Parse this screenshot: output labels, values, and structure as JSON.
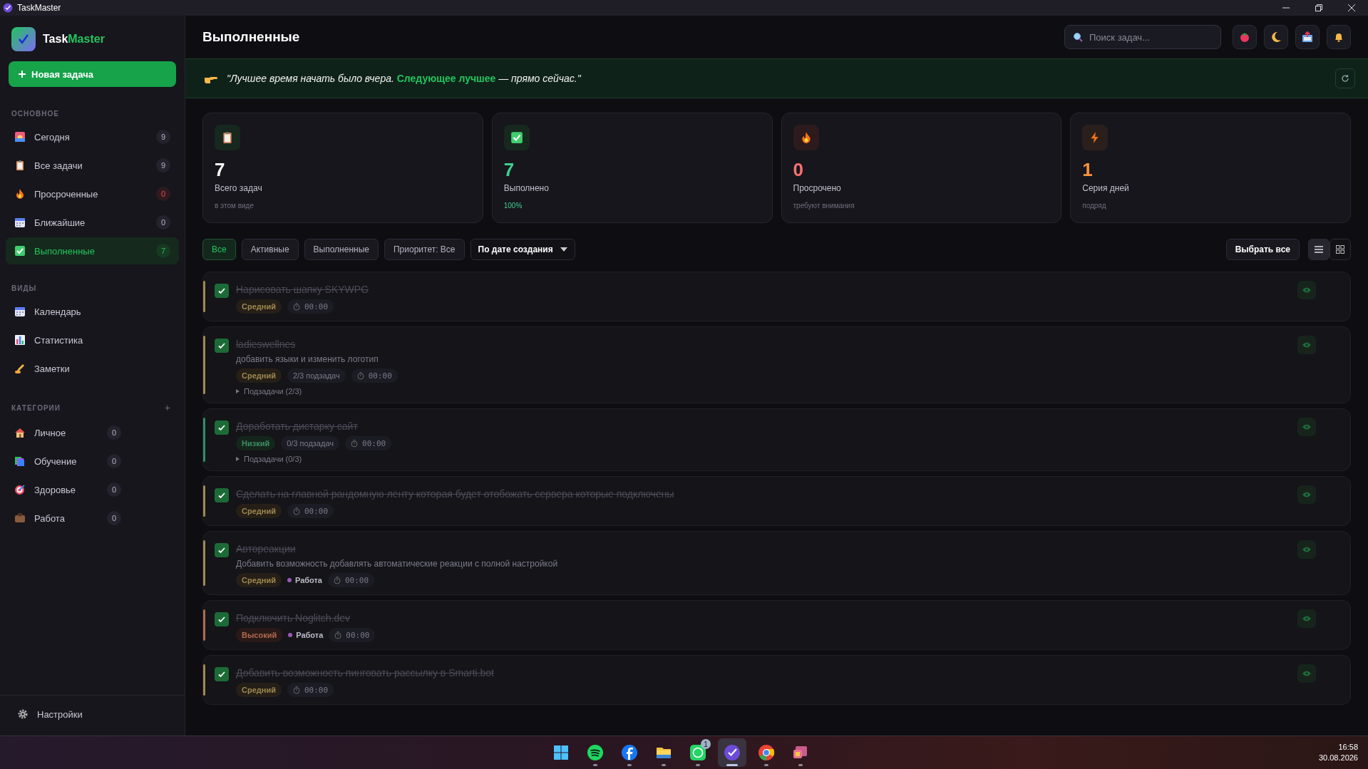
{
  "window": {
    "title": "TaskMaster"
  },
  "app": {
    "logo_part1": "Task",
    "logo_part2": "Master",
    "new_task": "Новая задача"
  },
  "sidebar": {
    "sections": [
      {
        "title": "ОСНОВНОЕ",
        "items": [
          {
            "kind": "today",
            "label": "Сегодня",
            "count": "9",
            "selected": false
          },
          {
            "kind": "all",
            "label": "Все задачи",
            "count": "9",
            "selected": false
          },
          {
            "kind": "overdue",
            "label": "Просроченные",
            "count": "0",
            "selected": false
          },
          {
            "kind": "upcoming",
            "label": "Ближайшие",
            "count": "0",
            "selected": false
          },
          {
            "kind": "done",
            "label": "Выполненные",
            "count": "7",
            "selected": true
          }
        ]
      },
      {
        "title": "ВИДЫ",
        "items": [
          {
            "label": "Календарь",
            "selected": false
          },
          {
            "label": "Статистика",
            "selected": false
          },
          {
            "label": "Заметки",
            "selected": false
          }
        ]
      },
      {
        "title": "КАТЕГОРИИ",
        "add": "+",
        "items": [
          {
            "label": "Личное",
            "count": "0",
            "selected": false
          },
          {
            "label": "Обучение",
            "count": "0",
            "selected": false
          },
          {
            "label": "Здоровье",
            "count": "0",
            "selected": false
          },
          {
            "label": "Работа",
            "count": "0",
            "selected": false
          }
        ]
      }
    ],
    "settings": "Настройки"
  },
  "header": {
    "title": "Выполненные",
    "search": {
      "placeholder": "Поиск задач..."
    }
  },
  "quote": {
    "before": "\"Лучшее время начать было вчера. ",
    "highlight": "Следующее лучшее",
    "after": " — прямо сейчас.\""
  },
  "stats": [
    {
      "kind": "total",
      "value": "7",
      "label": "Всего задач",
      "note": "в этом виде"
    },
    {
      "kind": "done",
      "value": "7",
      "label": "Выполнено",
      "note": "100%"
    },
    {
      "kind": "overdue",
      "value": "0",
      "label": "Просрочено",
      "note": "требуют внимания"
    },
    {
      "kind": "streak",
      "value": "1",
      "label": "Серия дней",
      "note": "подряд"
    }
  ],
  "filters": {
    "tabs": [
      {
        "label": "Все",
        "selected": true
      },
      {
        "label": "Активные",
        "selected": false
      },
      {
        "label": "Выполненные",
        "selected": false
      }
    ],
    "priority": "Приоритет: Все",
    "sort": "По дате создания",
    "select_all": "Выбрать все",
    "views": [
      {
        "kind": "list",
        "selected": true
      },
      {
        "kind": "grid",
        "selected": false
      }
    ]
  },
  "tasks": [
    {
      "title": "Нарисовать шапку SKYWPG",
      "done": true,
      "priority": {
        "label": "Средний",
        "kind": "medium"
      },
      "time": "00:00"
    },
    {
      "title": "ladieswellnes",
      "done": true,
      "description": "добавить языки и изменить логотип",
      "priority": {
        "label": "Средний",
        "kind": "medium"
      },
      "subtasks": "2/3 подзадач",
      "time": "00:00",
      "subtasks_toggle": "Подзадачи (2/3)"
    },
    {
      "title": "Доработать дистарку сайт",
      "done": true,
      "priority": {
        "label": "Низкий",
        "kind": "low"
      },
      "subtasks": "0/3 подзадач",
      "time": "00:00",
      "subtasks_toggle": "Подзадачи (0/3)"
    },
    {
      "title": "Сделать на главной рандомную ленту которая будет отобожать сервера которые подключены",
      "done": true,
      "priority": {
        "label": "Средний",
        "kind": "medium"
      },
      "time": "00:00"
    },
    {
      "title": "Автореакции",
      "done": true,
      "description": "Добавить возможность добавлять автоматические реакции с полной настройкой",
      "priority": {
        "label": "Средний",
        "kind": "medium"
      },
      "category": {
        "label": "Работа",
        "color": "#9b59b6"
      },
      "time": "00:00"
    },
    {
      "title": "Подключить Noglitch.dev",
      "done": true,
      "priority": {
        "label": "Высокий",
        "kind": "high"
      },
      "category": {
        "label": "Работа",
        "color": "#9b59b6"
      },
      "time": "00:00"
    },
    {
      "title": "Добавить возможность пинговать рассылку в Smarti.bot",
      "done": true,
      "priority": {
        "label": "Средний",
        "kind": "medium"
      },
      "time": "00:00"
    }
  ],
  "taskbar": {
    "apps": [
      {
        "kind": "windows",
        "selected": false
      },
      {
        "kind": "spotify",
        "selected": false
      },
      {
        "kind": "facebook",
        "selected": false
      },
      {
        "kind": "folder",
        "selected": false
      },
      {
        "kind": "whatsapp",
        "selected": false,
        "badge": "1"
      },
      {
        "kind": "taskmaster",
        "selected": true
      },
      {
        "kind": "chrome",
        "selected": false
      },
      {
        "kind": "teams",
        "selected": false
      }
    ],
    "time": "16:58",
    "date": "30.08.2026"
  }
}
